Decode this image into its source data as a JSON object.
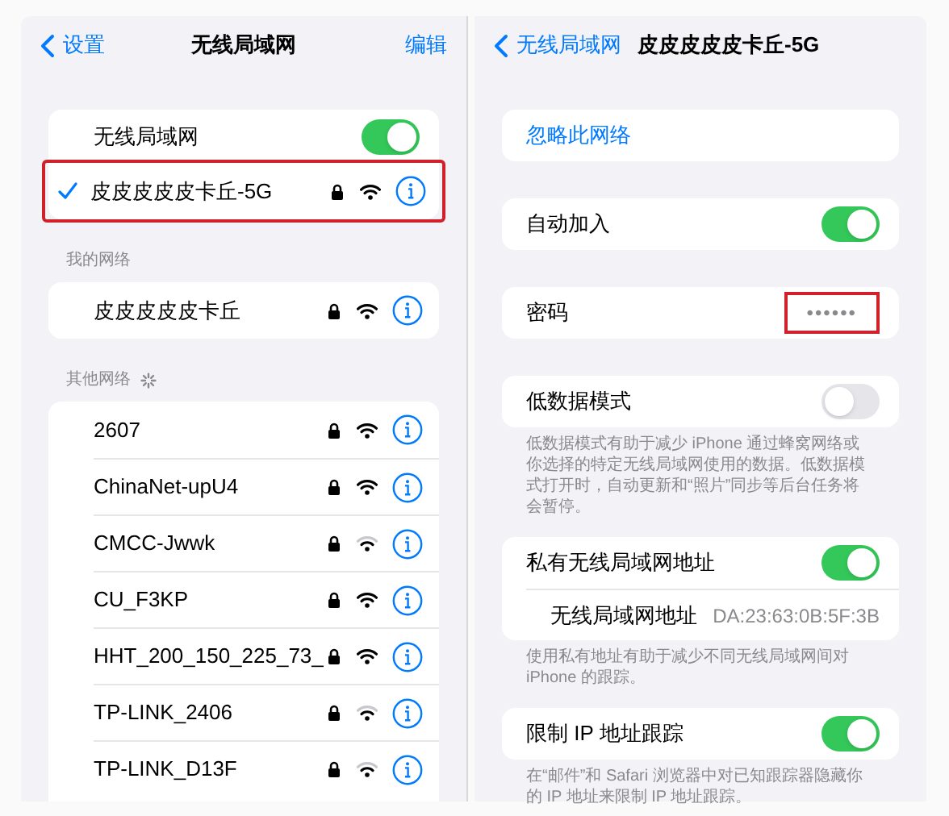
{
  "left": {
    "back": "设置",
    "title": "无线局域网",
    "edit": "编辑",
    "wifi_toggle": {
      "label": "无线局域网",
      "on": true
    },
    "current": {
      "name": "皮皮皮皮皮卡丘-5G",
      "selected": true,
      "highlighted": true,
      "weak": false
    },
    "my_networks": {
      "header": "我的网络",
      "networks": [
        {
          "name": "皮皮皮皮皮卡丘",
          "weak": false
        }
      ]
    },
    "other_networks": {
      "header": "其他网络",
      "networks": [
        {
          "name": "2607",
          "weak": false
        },
        {
          "name": "ChinaNet-upU4",
          "weak": false
        },
        {
          "name": "CMCC-Jwwk",
          "weak": true
        },
        {
          "name": "CU_F3KP",
          "weak": false
        },
        {
          "name": "HHT_200_150_225_73_",
          "weak": false
        },
        {
          "name": "TP-LINK_2406",
          "weak": true
        },
        {
          "name": "TP-LINK_D13F",
          "weak": true
        }
      ]
    }
  },
  "right": {
    "back": "无线局域网",
    "title": "皮皮皮皮皮卡丘-5G",
    "forget": "忽略此网络",
    "auto_join": {
      "label": "自动加入",
      "on": true
    },
    "password": {
      "label": "密码",
      "value": "••••••",
      "highlighted": true
    },
    "low_data": {
      "label": "低数据模式",
      "on": false,
      "note": "低数据模式有助于减少 iPhone 通过蜂窝网络或你选择的特定无线局域网使用的数据。低数据模式打开时，自动更新和“照片”同步等后台任务将会暂停。"
    },
    "private_address": {
      "label": "私有无线局域网地址",
      "on": true
    },
    "address": {
      "label": "无线局域网地址",
      "value": "DA:23:63:0B:5F:3B",
      "note": "使用私有地址有助于减少不同无线局域网间对 iPhone 的跟踪。"
    },
    "limit_ip": {
      "label": "限制 IP 地址跟踪",
      "on": true,
      "note": "在“邮件”和 Safari 浏览器中对已知跟踪器隐藏你的 IP 地址来限制 IP 地址跟踪。"
    }
  }
}
